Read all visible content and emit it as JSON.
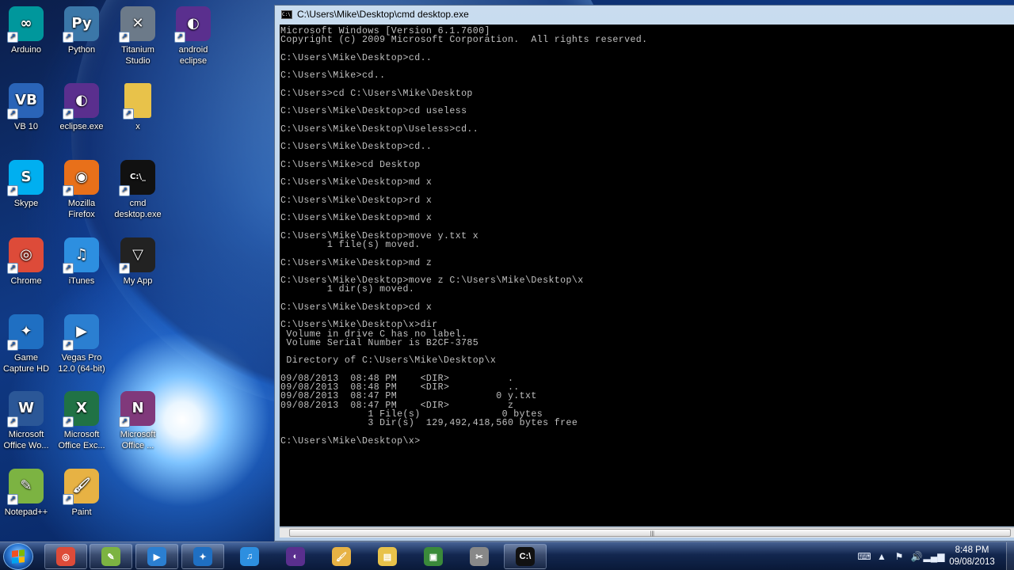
{
  "desktop": {
    "icons": [
      {
        "label": "Arduino",
        "icon": "arduino-icon",
        "color": "#00979c",
        "glyph": "∞"
      },
      {
        "label": "Python",
        "icon": "python-icon",
        "color": "#3b77a8",
        "glyph": "Py"
      },
      {
        "label": "Titanium Studio",
        "icon": "titanium-studio-icon",
        "color": "#6c7a89",
        "glyph": "✕"
      },
      {
        "label": "android eclipse",
        "icon": "eclipse-icon",
        "color": "#5a2f8e",
        "glyph": "◐"
      },
      {
        "label": "VB 10",
        "icon": "vb-icon",
        "color": "#2a64b8",
        "glyph": "VB"
      },
      {
        "label": "eclipse.exe",
        "icon": "eclipse-icon",
        "color": "#5a2f8e",
        "glyph": "◐"
      },
      {
        "label": "x",
        "icon": "folder-icon",
        "color": "#e8c24a",
        "glyph": ""
      },
      {
        "label": "Skype",
        "icon": "skype-icon",
        "color": "#00aff0",
        "glyph": "S"
      },
      {
        "label": "Mozilla Firefox",
        "icon": "firefox-icon",
        "color": "#e8701a",
        "glyph": "◉"
      },
      {
        "label": "cmd desktop.exe",
        "icon": "cmd-icon",
        "color": "#111111",
        "glyph": "C:\\_"
      },
      {
        "label": "Chrome",
        "icon": "chrome-icon",
        "color": "#dd4b39",
        "glyph": "◎"
      },
      {
        "label": "iTunes",
        "icon": "itunes-icon",
        "color": "#2d8fe0",
        "glyph": "♫"
      },
      {
        "label": "My App",
        "icon": "my-app-icon",
        "color": "#222222",
        "glyph": "▽"
      },
      {
        "label": "Game Capture HD",
        "icon": "game-capture-icon",
        "color": "#1f6fc2",
        "glyph": "✦"
      },
      {
        "label": "Vegas Pro 12.0 (64-bit)",
        "icon": "vegas-pro-icon",
        "color": "#2b7fd1",
        "glyph": "▶"
      },
      {
        "label": "Microsoft Office Wo...",
        "icon": "word-icon",
        "color": "#2b5797",
        "glyph": "W"
      },
      {
        "label": "Microsoft Office Exc...",
        "icon": "excel-icon",
        "color": "#207245",
        "glyph": "X"
      },
      {
        "label": "Microsoft Office ...",
        "icon": "onenote-icon",
        "color": "#80397b",
        "glyph": "N"
      },
      {
        "label": "Notepad++",
        "icon": "notepad-plus-plus-icon",
        "color": "#7cb342",
        "glyph": "✎"
      },
      {
        "label": "Paint",
        "icon": "paint-icon",
        "color": "#e7b244",
        "glyph": "🖌"
      }
    ]
  },
  "cmd": {
    "title": "C:\\Users\\Mike\\Desktop\\cmd desktop.exe",
    "lines": [
      "Microsoft Windows [Version 6.1.7600]",
      "Copyright (c) 2009 Microsoft Corporation.  All rights reserved.",
      "",
      "C:\\Users\\Mike\\Desktop>cd..",
      "",
      "C:\\Users\\Mike>cd..",
      "",
      "C:\\Users>cd C:\\Users\\Mike\\Desktop",
      "",
      "C:\\Users\\Mike\\Desktop>cd useless",
      "",
      "C:\\Users\\Mike\\Desktop\\Useless>cd..",
      "",
      "C:\\Users\\Mike\\Desktop>cd..",
      "",
      "C:\\Users\\Mike>cd Desktop",
      "",
      "C:\\Users\\Mike\\Desktop>md x",
      "",
      "C:\\Users\\Mike\\Desktop>rd x",
      "",
      "C:\\Users\\Mike\\Desktop>md x",
      "",
      "C:\\Users\\Mike\\Desktop>move y.txt x",
      "        1 file(s) moved.",
      "",
      "C:\\Users\\Mike\\Desktop>md z",
      "",
      "C:\\Users\\Mike\\Desktop>move z C:\\Users\\Mike\\Desktop\\x",
      "        1 dir(s) moved.",
      "",
      "C:\\Users\\Mike\\Desktop>cd x",
      "",
      "C:\\Users\\Mike\\Desktop\\x>dir",
      " Volume in drive C has no label.",
      " Volume Serial Number is B2CF-3785",
      "",
      " Directory of C:\\Users\\Mike\\Desktop\\x",
      "",
      "09/08/2013  08:48 PM    <DIR>          .",
      "09/08/2013  08:48 PM    <DIR>          ..",
      "09/08/2013  08:47 PM                 0 y.txt",
      "09/08/2013  08:47 PM    <DIR>          z",
      "               1 File(s)              0 bytes",
      "               3 Dir(s)  129,492,418,560 bytes free",
      "",
      "C:\\Users\\Mike\\Desktop\\x>"
    ]
  },
  "taskbar": {
    "pinned": [
      {
        "name": "taskbar-chrome-icon",
        "color": "#dd4b39",
        "glyph": "◎"
      },
      {
        "name": "taskbar-notepad-plus-plus-icon",
        "color": "#7cb342",
        "glyph": "✎"
      },
      {
        "name": "taskbar-vegas-pro-icon",
        "color": "#2b7fd1",
        "glyph": "▶"
      },
      {
        "name": "taskbar-game-capture-icon",
        "color": "#1f6fc2",
        "glyph": "✦"
      },
      {
        "name": "taskbar-itunes-icon",
        "color": "#2d8fe0",
        "glyph": "♫"
      },
      {
        "name": "taskbar-eclipse-icon",
        "color": "#5a2f8e",
        "glyph": "◐"
      },
      {
        "name": "taskbar-paint-icon",
        "color": "#e7b244",
        "glyph": "🖌"
      },
      {
        "name": "taskbar-explorer-icon",
        "color": "#e8c24a",
        "glyph": "▤"
      },
      {
        "name": "taskbar-app-icon",
        "color": "#3a8a3a",
        "glyph": "▣"
      },
      {
        "name": "taskbar-snipping-icon",
        "color": "#888888",
        "glyph": "✂"
      },
      {
        "name": "taskbar-cmd-icon",
        "color": "#111111",
        "glyph": "C:\\"
      }
    ],
    "clock": {
      "time": "8:48 PM",
      "date": "09/08/2013"
    }
  }
}
